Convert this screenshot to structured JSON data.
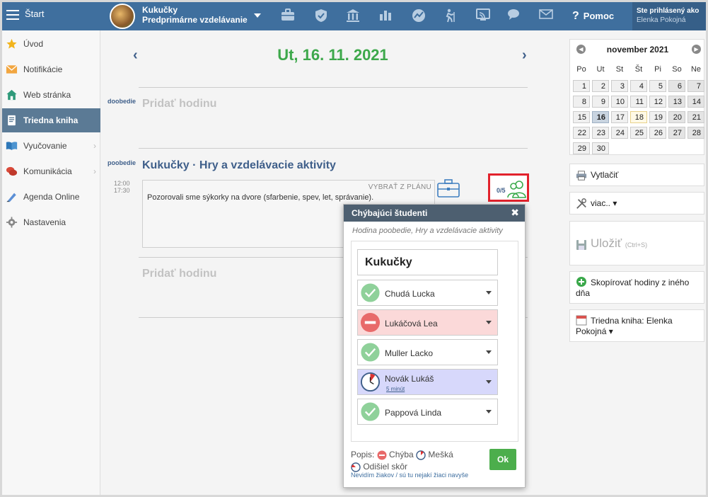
{
  "topbar": {
    "start_label": "Štart",
    "class_name_1": "Kukučky",
    "class_name_2": "Predprimárne vzdelávanie",
    "help_label": "Pomoc",
    "user_line1": "Ste prihlásený ako",
    "user_line2": "Elenka Pokojná"
  },
  "sidebar": {
    "items": [
      {
        "label": "Úvod",
        "icon": "star-icon"
      },
      {
        "label": "Notifikácie",
        "icon": "envelope-icon"
      },
      {
        "label": "Web stránka",
        "icon": "home-icon"
      },
      {
        "label": "Triedna kniha",
        "icon": "book-icon"
      },
      {
        "label": "Vyučovanie",
        "icon": "open-book-icon"
      },
      {
        "label": "Komunikácia",
        "icon": "chat-icon"
      },
      {
        "label": "Agenda Online",
        "icon": "pen-icon"
      },
      {
        "label": "Nastavenia",
        "icon": "gear-icon"
      }
    ],
    "arrow": "›"
  },
  "main": {
    "date": "Ut, 16. 11. 2021",
    "prev": "‹",
    "next": "›",
    "slot1_label": "doobedie",
    "add_hour": "Pridať hodinu",
    "slot2_label": "poobedie",
    "lesson_title": "Kukučky · Hry a vzdelávacie aktivity",
    "time_from": "12:00",
    "time_to": "17:30",
    "from_plan": "VYBRAŤ Z PLÁNU",
    "lesson_text": "Pozorovali sme sýkorky na dvore (sfarbenie, spev, let, správanie).",
    "attendance_count": "0/5"
  },
  "popup": {
    "title": "Chýbajúci študenti",
    "close": "✖",
    "subtitle": "Hodina poobedie, Hry a vzdelávacie aktivity",
    "group": "Kukučky",
    "students": [
      {
        "name": "Chudá Lucka",
        "status": "present",
        "note": ""
      },
      {
        "name": "Lukáčová Lea",
        "status": "absent",
        "note": ""
      },
      {
        "name": "Muller Lacko",
        "status": "present",
        "note": ""
      },
      {
        "name": "Novák Lukáš",
        "status": "late",
        "note": "5 minút"
      },
      {
        "name": "Pappová Linda",
        "status": "present",
        "note": ""
      }
    ],
    "legend_label": "Popis:",
    "legend_absent": "Chýba",
    "legend_late": "Mešká",
    "legend_left": "Odišiel skôr",
    "hint": "Nevidím žiakov / sú tu nejakí žiaci navyše",
    "ok": "Ok"
  },
  "calendar": {
    "month": "november 2021",
    "prev": "◀",
    "next": "▶",
    "dow": [
      "Po",
      "Ut",
      "St",
      "Št",
      "Pi",
      "So",
      "Ne"
    ],
    "weeks": [
      [
        "1",
        "2",
        "3",
        "4",
        "5",
        "6",
        "7"
      ],
      [
        "8",
        "9",
        "10",
        "11",
        "12",
        "13",
        "14"
      ],
      [
        "15",
        "16",
        "17",
        "18",
        "19",
        "20",
        "21"
      ],
      [
        "22",
        "23",
        "24",
        "25",
        "26",
        "27",
        "28"
      ],
      [
        "29",
        "30",
        "",
        "",
        "",
        "",
        ""
      ]
    ]
  },
  "right": {
    "print": "Vytlačiť",
    "more": "viac.. ▾",
    "save": "Uložiť",
    "save_hint": "(Ctrl+S)",
    "copy": "Skopírovať hodiny z iného dňa",
    "book": "Triedna kniha: Elenka Pokojná ▾"
  },
  "colors": {
    "topbar": "#3f6f9e",
    "date_green": "#3da84b",
    "title_blue": "#3f5f8a",
    "highlight_red": "#e2222c",
    "ok_green": "#4cae4c"
  }
}
